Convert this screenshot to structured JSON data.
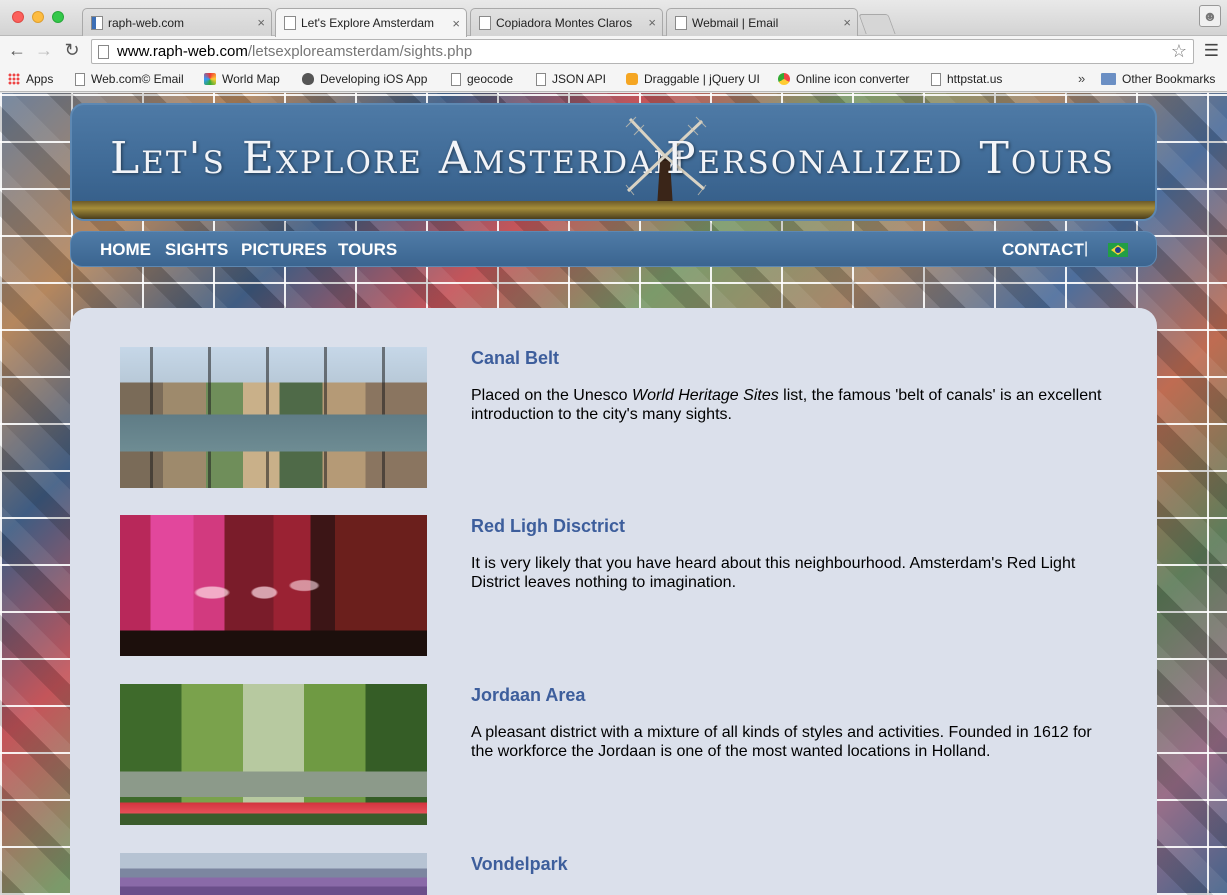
{
  "browser": {
    "tabs": [
      {
        "label": "raph-web.com",
        "active": false
      },
      {
        "label": "Let's Explore Amsterdam",
        "active": true
      },
      {
        "label": "Copiadora Montes Claros",
        "active": false
      },
      {
        "label": "Webmail | Email",
        "active": false
      }
    ],
    "close_glyph": "×",
    "url_host": "www.raph-web.com",
    "url_path": "/letsexploreamsterdam/sights.php",
    "bookmarks": [
      {
        "label": "Apps",
        "icon": "apps-icon"
      },
      {
        "label": "Web.com© Email",
        "icon": "page-icon"
      },
      {
        "label": "World Map",
        "icon": "world-map-icon"
      },
      {
        "label": "Developing iOS App",
        "icon": "apple-icon"
      },
      {
        "label": "geocode",
        "icon": "page-icon"
      },
      {
        "label": "JSON API",
        "icon": "page-icon"
      },
      {
        "label": "Draggable | jQuery UI",
        "icon": "jquery-icon"
      },
      {
        "label": "Online icon converter",
        "icon": "chrome-icon"
      },
      {
        "label": "httpstat.us",
        "icon": "page-icon"
      }
    ],
    "overflow_glyph": "»",
    "other_bookmarks": "Other Bookmarks"
  },
  "site": {
    "banner_left": "Let's Explore Amsterdam",
    "banner_right": "Personalized Tours",
    "nav": {
      "home": "HOME",
      "sights": "SIGHTS",
      "pictures": "PICTURES",
      "tours": "TOURS",
      "contact": "CONTACT",
      "separator": "|"
    }
  },
  "sights": [
    {
      "title": "Canal Belt",
      "desc_before": "Placed on the Unesco ",
      "desc_em": "World Heritage Sites",
      "desc_after": " list, the famous 'belt of canals' is an excellent introduction to the city's many sights."
    },
    {
      "title": "Red Ligh Disctrict",
      "desc": "It is very likely that you have heard about this neighbourhood. Amsterdam's Red Light District leaves nothing to imagination."
    },
    {
      "title": "Jordaan Area",
      "desc": "A pleasant district with a mixture of all kinds of styles and activities. Founded in 1612 for the workforce the Jordaan is one of the most wanted locations in Holland."
    },
    {
      "title": "Vondelpark"
    }
  ]
}
